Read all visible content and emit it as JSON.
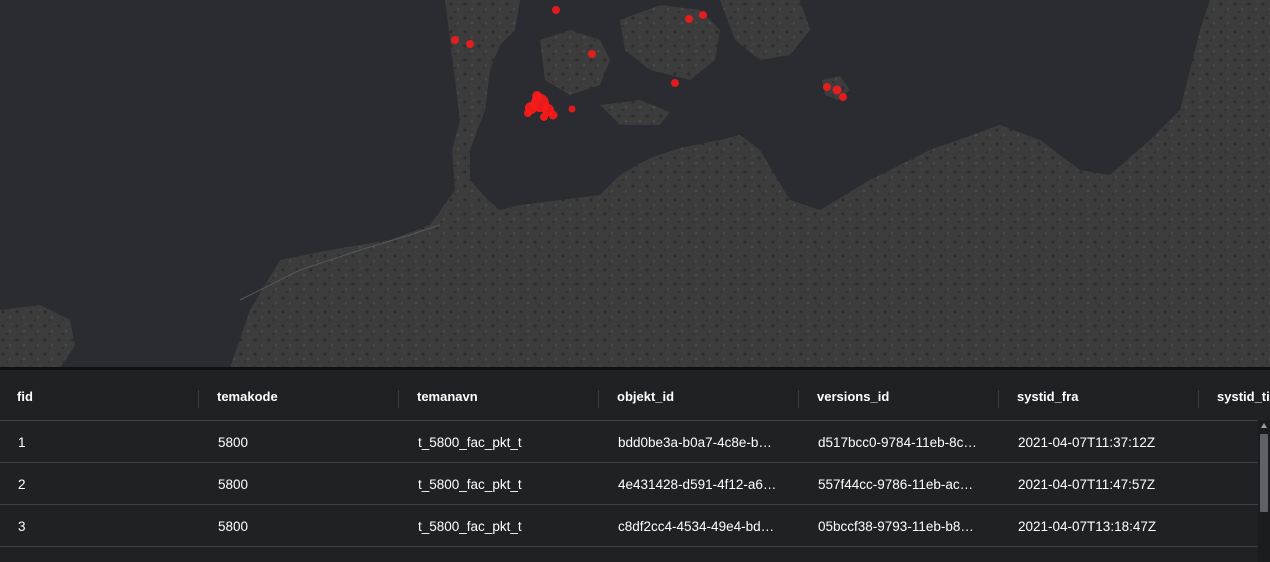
{
  "map": {
    "basemap": "dark-satellite",
    "feature_color": "#ff1a1a"
  },
  "table": {
    "columns": [
      "fid",
      "temakode",
      "temanavn",
      "objekt_id",
      "versions_id",
      "systid_fra",
      "systid_til"
    ],
    "rows": [
      [
        "1",
        "5800",
        "t_5800_fac_pkt_t",
        "bdd0be3a-b0a7-4c8e-b…",
        "d517bcc0-9784-11eb-8c…",
        "2021-04-07T11:37:12Z"
      ],
      [
        "2",
        "5800",
        "t_5800_fac_pkt_t",
        "4e431428-d591-4f12-a6…",
        "557f44cc-9786-11eb-ac…",
        "2021-04-07T11:47:57Z"
      ],
      [
        "3",
        "5800",
        "t_5800_fac_pkt_t",
        "c8df2cc4-4534-49e4-bd…",
        "05bccf38-9793-11eb-b8…",
        "2021-04-07T13:18:47Z"
      ]
    ]
  }
}
